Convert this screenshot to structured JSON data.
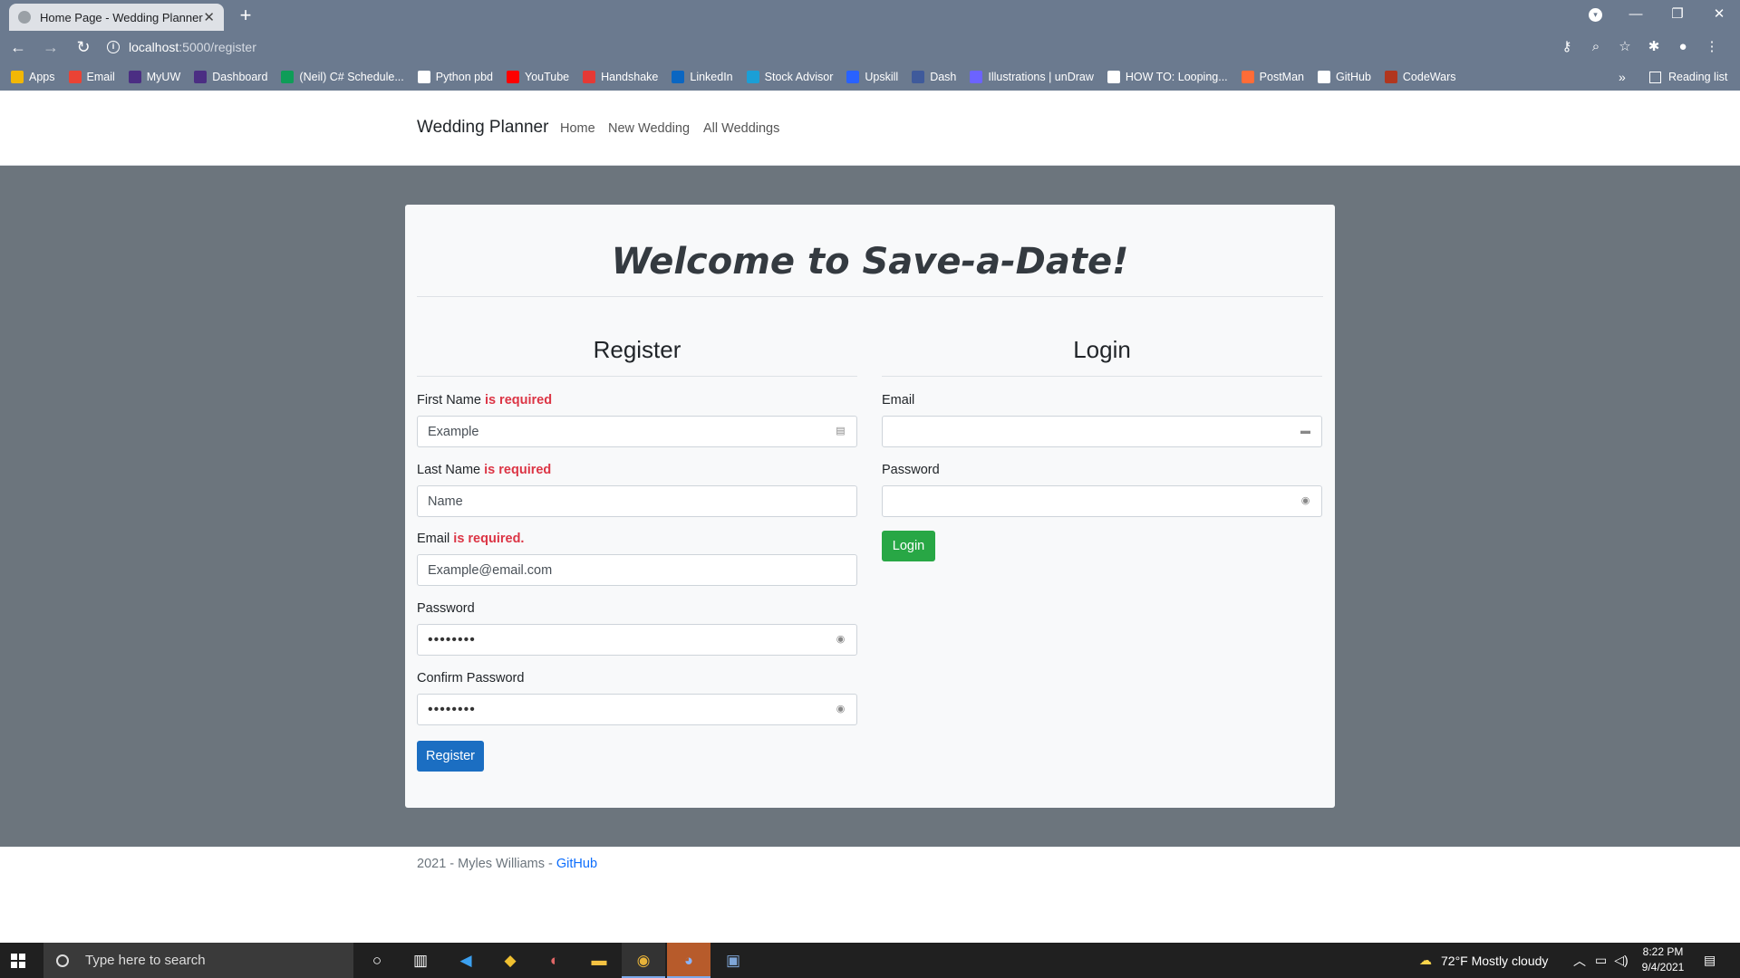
{
  "browser": {
    "tab_title": "Home Page - Wedding Planner",
    "tab_close": "✕",
    "new_tab": "+",
    "url_host": "localhost",
    "url_path": ":5000/register",
    "bookmarks": [
      {
        "label": "Apps",
        "icon": "apps-grid-icon",
        "color": "#f2b705"
      },
      {
        "label": "Email",
        "icon": "gmail-icon",
        "color": "#ea4335"
      },
      {
        "label": "MyUW",
        "icon": "uw-icon",
        "color": "#4b2e83"
      },
      {
        "label": "Dashboard",
        "icon": "uw-dashboard-icon",
        "color": "#4b2e83"
      },
      {
        "label": "(Neil) C# Schedule...",
        "icon": "sheets-icon",
        "color": "#0f9d58"
      },
      {
        "label": "Python pbd",
        "icon": "python-icon",
        "color": "#ffffff"
      },
      {
        "label": "YouTube",
        "icon": "youtube-icon",
        "color": "#ff0000"
      },
      {
        "label": "Handshake",
        "icon": "handshake-icon",
        "color": "#e53935"
      },
      {
        "label": "LinkedIn",
        "icon": "linkedin-icon",
        "color": "#0a66c2"
      },
      {
        "label": "Stock Advisor",
        "icon": "stock-advisor-icon",
        "color": "#1b9fd6"
      },
      {
        "label": "Upskill",
        "icon": "upskill-icon",
        "color": "#2962ff"
      },
      {
        "label": "Dash",
        "icon": "dash-icon",
        "color": "#3f5a9b"
      },
      {
        "label": "Illustrations | unDraw",
        "icon": "undraw-icon",
        "color": "#6c63ff"
      },
      {
        "label": "HOW TO: Looping...",
        "icon": "doc-icon",
        "color": "#ffffff"
      },
      {
        "label": "PostMan",
        "icon": "postman-icon",
        "color": "#ff6c37"
      },
      {
        "label": "GitHub",
        "icon": "github-icon",
        "color": "#ffffff"
      },
      {
        "label": "CodeWars",
        "icon": "codewars-icon",
        "color": "#b1361e"
      }
    ],
    "more_bookmarks": "»",
    "reading_list": "Reading list"
  },
  "site": {
    "brand": "Wedding Planner",
    "nav": [
      "Home",
      "New Wedding",
      "All Weddings"
    ]
  },
  "card": {
    "welcome": "Welcome to Save-a-Date!",
    "register": {
      "title": "Register",
      "first_name_label": "First Name",
      "first_name_error": "is required",
      "first_name_value": "Example",
      "last_name_label": "Last Name",
      "last_name_error": "is required",
      "last_name_value": "Name",
      "email_label": "Email",
      "email_error": "is required.",
      "email_value": "Example@email.com",
      "password_label": "Password",
      "password_value": "••••••••",
      "confirm_label": "Confirm Password",
      "confirm_value": "••••••••",
      "button": "Register"
    },
    "login": {
      "title": "Login",
      "email_label": "Email",
      "email_value": "",
      "password_label": "Password",
      "password_value": "",
      "button": "Login"
    }
  },
  "footer": {
    "text": "2021 - Myles Williams - ",
    "link": "GitHub"
  },
  "taskbar": {
    "search_placeholder": "Type here to search",
    "weather": "72°F  Mostly cloudy",
    "time": "8:22 PM",
    "date": "9/4/2021"
  },
  "colors": {
    "primary": "#1b6ec2",
    "success": "#28a745",
    "danger": "#dc3545",
    "page_bg": "#6c757d"
  }
}
